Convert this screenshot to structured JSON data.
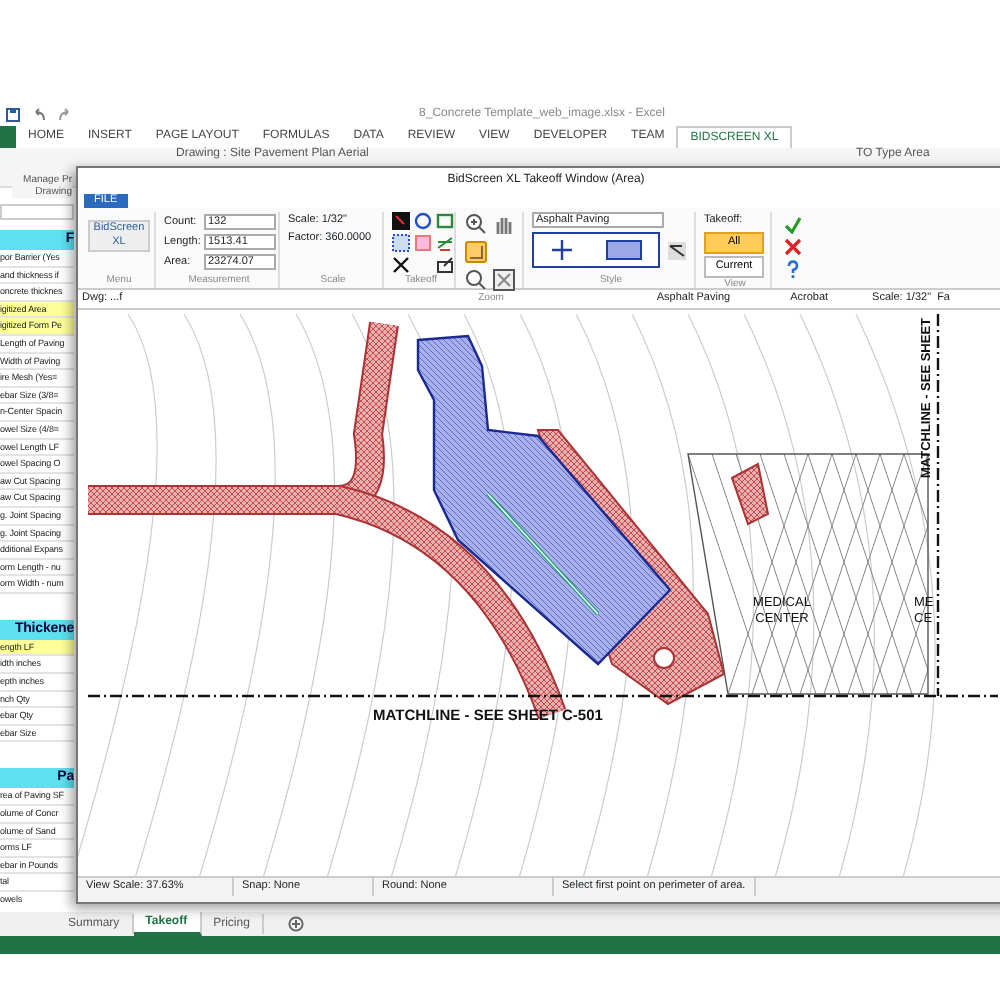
{
  "excel": {
    "title": "8_Concrete Template_web_image.xlsx - Excel",
    "ribbon_tabs": [
      {
        "label": "HOME",
        "selected": false
      },
      {
        "label": "INSERT",
        "selected": false
      },
      {
        "label": "PAGE LAYOUT",
        "selected": false
      },
      {
        "label": "FORMULAS",
        "selected": false
      },
      {
        "label": "DATA",
        "selected": false
      },
      {
        "label": "REVIEW",
        "selected": false
      },
      {
        "label": "VIEW",
        "selected": false
      },
      {
        "label": "DEVELOPER",
        "selected": false
      },
      {
        "label": "TEAM",
        "selected": false
      },
      {
        "label": "BIDSCREEN XL",
        "selected": true
      }
    ],
    "ribbon_text": [
      "Drawing : Site Pavement Plan Aerial",
      "TO Type Area"
    ],
    "manage_button": [
      "Manage Pr",
      "Drawing"
    ]
  },
  "sheet": {
    "sections": [
      {
        "header": "F",
        "rows": [
          {
            "text": "por Barrier (Yes",
            "highlighted": false
          },
          {
            "text": "and thickness if",
            "highlighted": false
          },
          {
            "text": "oncrete thicknes",
            "highlighted": false
          },
          {
            "text": "igitized Area",
            "highlighted": true
          },
          {
            "text": "igitized Form Pe",
            "highlighted": true
          },
          {
            "text": "Length of Paving",
            "highlighted": false
          },
          {
            "text": "Width of Paving",
            "highlighted": false
          },
          {
            "text": "ire Mesh (Yes=",
            "highlighted": false
          },
          {
            "text": "ebar Size (3/8=",
            "highlighted": false
          },
          {
            "text": "n-Center Spacin",
            "highlighted": false
          },
          {
            "text": "owel Size (4/8=",
            "highlighted": false
          },
          {
            "text": "owel Length LF",
            "highlighted": false
          },
          {
            "text": "owel Spacing O",
            "highlighted": false
          },
          {
            "text": "aw Cut Spacing",
            "highlighted": false
          },
          {
            "text": "aw Cut Spacing",
            "highlighted": false
          },
          {
            "text": "g. Joint Spacing",
            "highlighted": false
          },
          {
            "text": "g. Joint Spacing",
            "highlighted": false
          },
          {
            "text": "dditional Expans",
            "highlighted": false
          },
          {
            "text": "orm Length - nu",
            "highlighted": false
          },
          {
            "text": "orm Width - num",
            "highlighted": false
          }
        ]
      },
      {
        "header": "Thickene",
        "rows": [
          {
            "text": "ength LF",
            "highlighted": true
          },
          {
            "text": "idth inches",
            "highlighted": false
          },
          {
            "text": "epth inches",
            "highlighted": false
          },
          {
            "text": "nch Qty",
            "highlighted": false
          },
          {
            "text": "ebar Qty",
            "highlighted": false
          },
          {
            "text": "ebar Size",
            "highlighted": false
          }
        ]
      },
      {
        "header": "Pa",
        "rows": [
          {
            "text": "rea of Paving SF",
            "highlighted": false
          },
          {
            "text": "olume of Concr",
            "highlighted": false
          },
          {
            "text": "olume of Sand",
            "highlighted": false
          },
          {
            "text": "orms LF",
            "highlighted": false
          },
          {
            "text": "ebar in Pounds",
            "highlighted": false
          },
          {
            "text": "tal",
            "highlighted": false
          },
          {
            "text": "owels",
            "highlighted": false
          }
        ]
      }
    ]
  },
  "sheet_tabs": [
    {
      "label": "Summary",
      "selected": false
    },
    {
      "label": "Takeoff",
      "selected": true
    },
    {
      "label": "Pricing",
      "selected": false
    }
  ],
  "window": {
    "title": "BidScreen XL Takeoff Window (Area)",
    "file_tab": "FILE",
    "menu": "BidScreen XL",
    "measurement": [
      {
        "label": "Count:",
        "value": "132"
      },
      {
        "label": "Length:",
        "value": "1513.41"
      },
      {
        "label": "Area:",
        "value": "23274.07"
      }
    ],
    "scale": [
      "Scale: 1/32\"",
      "Factor: 360.0000"
    ],
    "style": "Asphalt Paving",
    "view": {
      "label": "Takeoff:",
      "options": [
        {
          "label": "All",
          "selected": true
        },
        {
          "label": "Current",
          "selected": false
        }
      ]
    },
    "groups": [
      "Menu",
      "Measurement",
      "Scale",
      "Takeoff",
      "Zoom",
      "Style",
      "View"
    ],
    "info_bar": [
      "Dwg: ...f",
      "Asphalt Paving",
      "Acrobat",
      "Scale: 1/32\"  Fa"
    ],
    "drawing": {
      "labels": [
        {
          "kind": "matchline-h",
          "text": "MATCHLINE - SEE SHEET C-501"
        },
        {
          "kind": "matchline-v",
          "text": "MATCHLINE - SEE SHEET"
        },
        {
          "kind": "building",
          "text": "MEDICAL"
        },
        {
          "kind": "building",
          "text": "CENTER"
        },
        {
          "kind": "cut",
          "text": "ME"
        },
        {
          "kind": "cut2",
          "text": "CE"
        }
      ]
    },
    "status": [
      "View Scale: 37.63%",
      "Snap: None",
      "Round: None",
      "Select first point on perimeter of area."
    ]
  }
}
